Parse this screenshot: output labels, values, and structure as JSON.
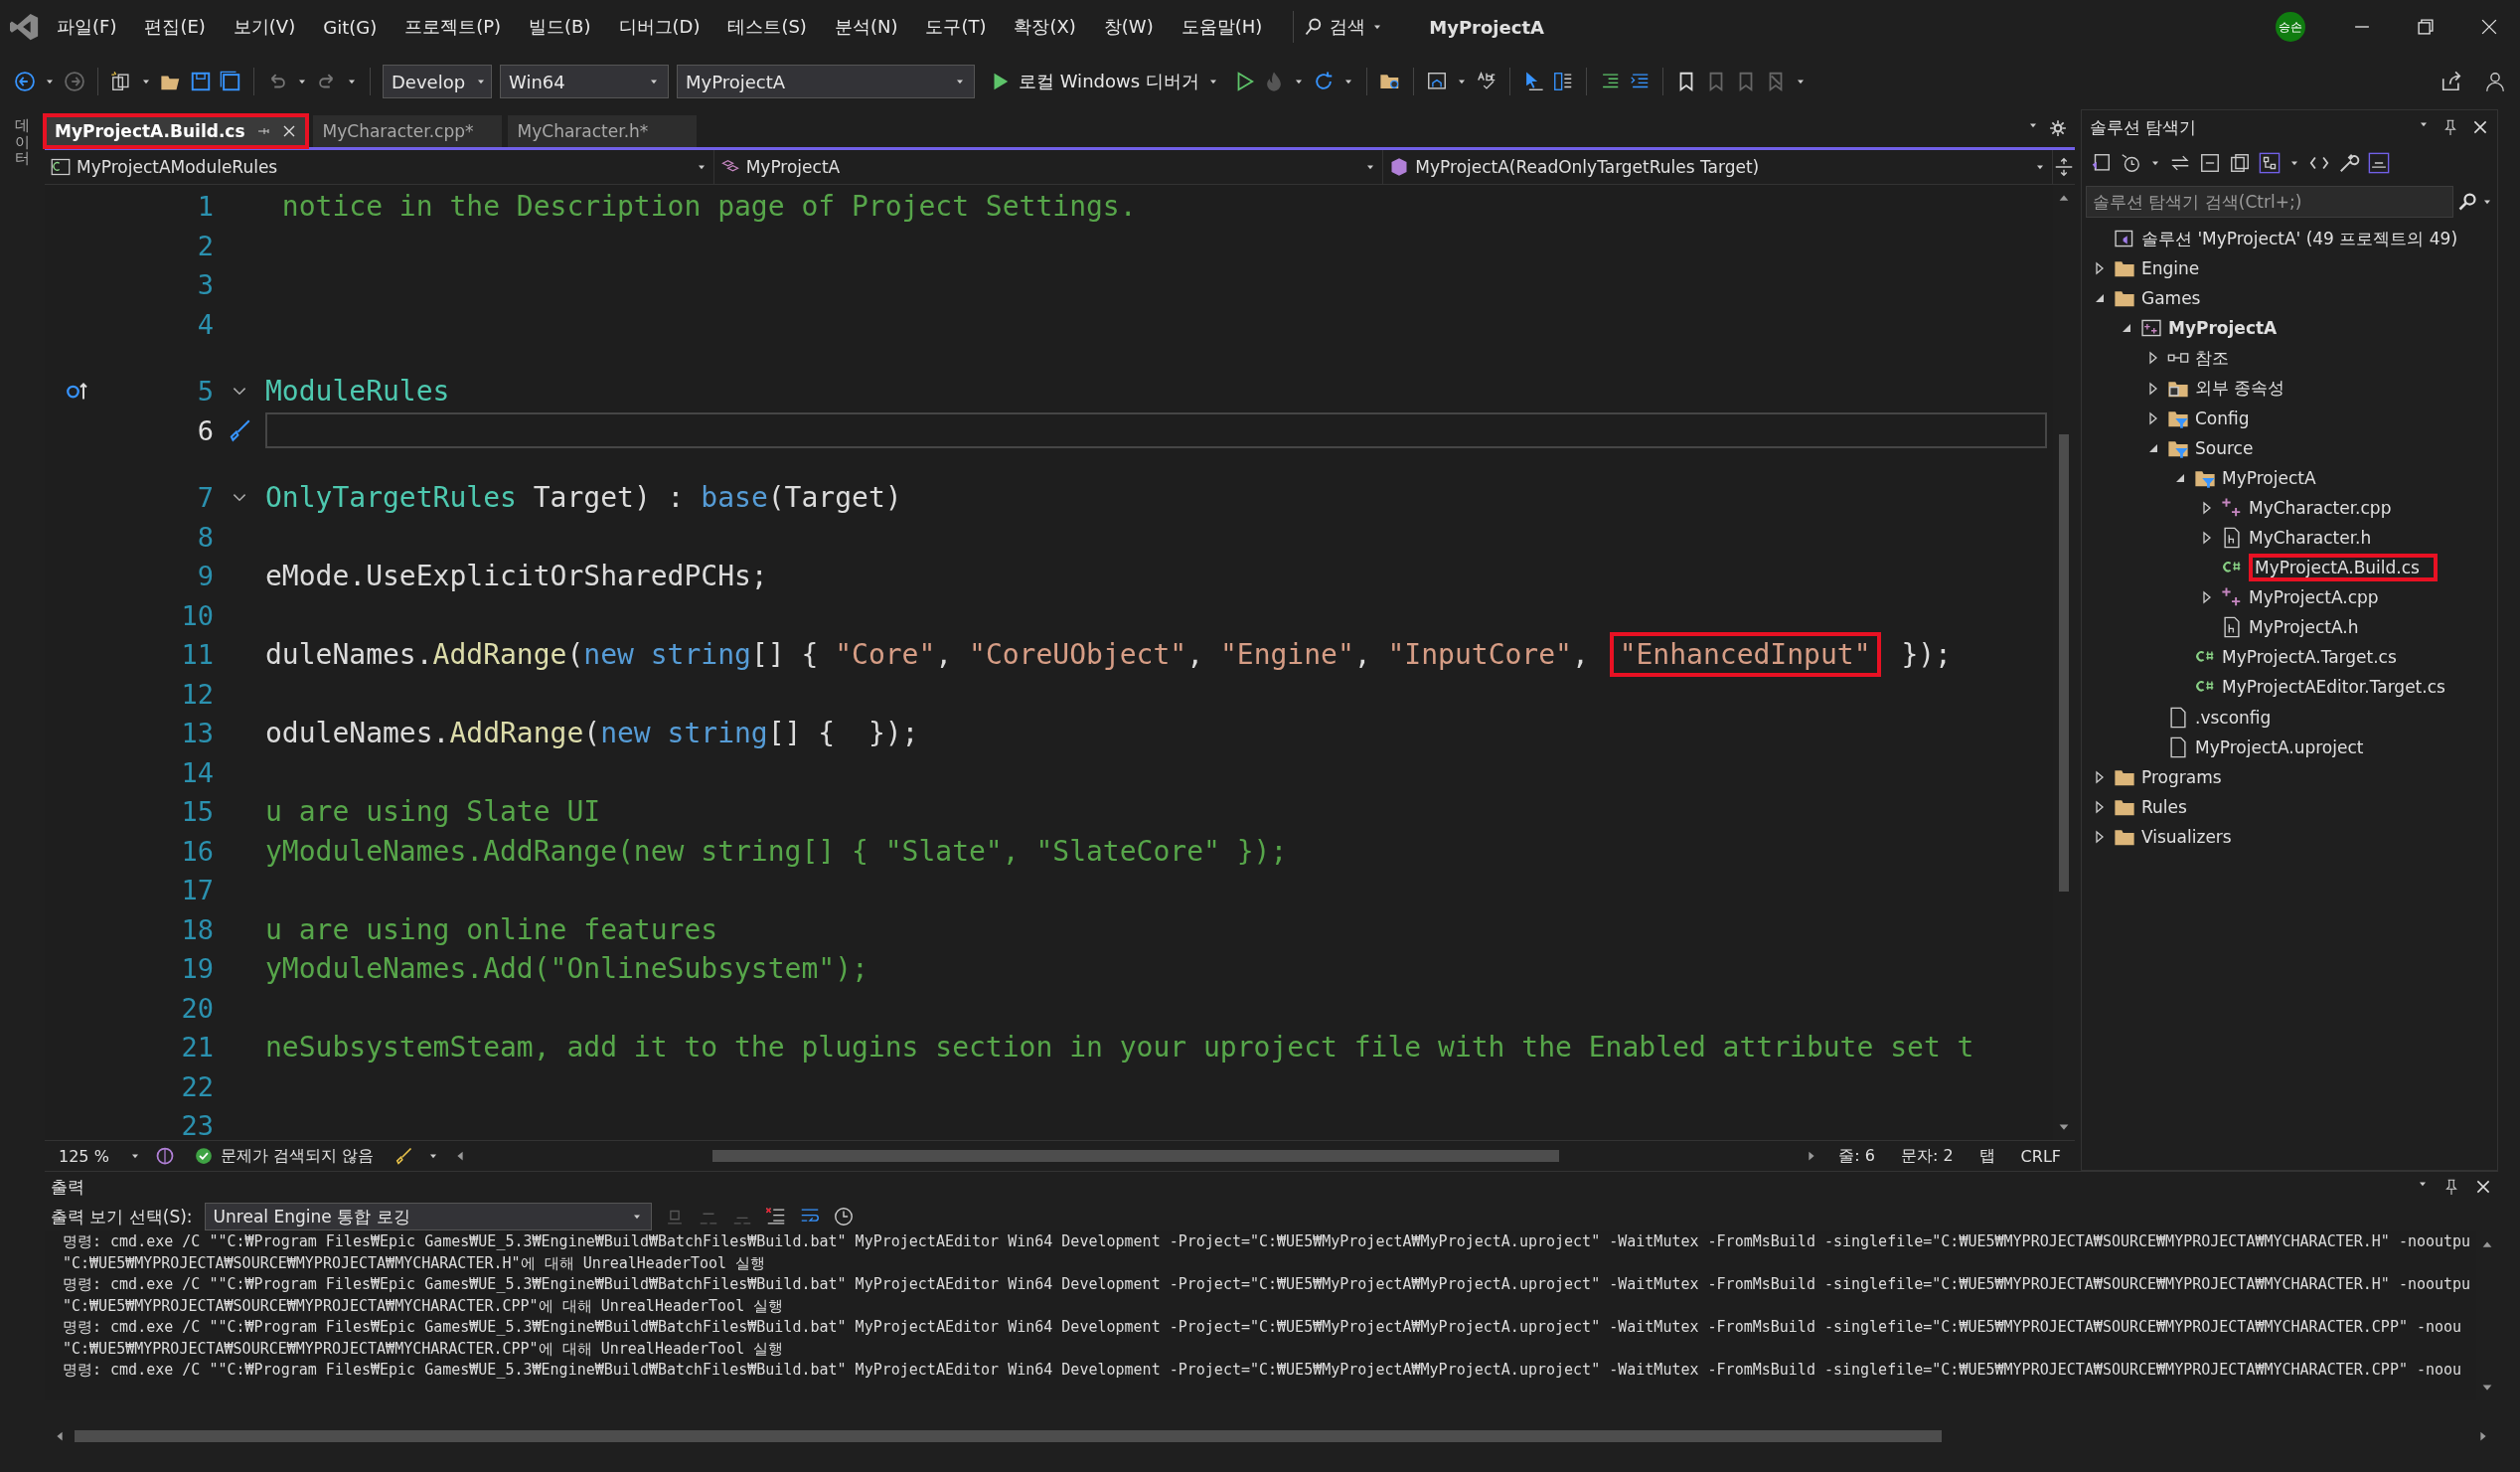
{
  "title_bar": {
    "menus": [
      "파일(F)",
      "편집(E)",
      "보기(V)",
      "Git(G)",
      "프로젝트(P)",
      "빌드(B)",
      "디버그(D)",
      "테스트(S)",
      "분석(N)",
      "도구(T)",
      "확장(X)",
      "창(W)",
      "도움말(H)"
    ],
    "search": "검색",
    "title": "MyProjectA",
    "avatar": "승손"
  },
  "toolbar": {
    "dropdowns": [
      "Develop",
      "Win64",
      "MyProjectA"
    ],
    "run_label": "로컬 Windows 디버거"
  },
  "left_strip": {
    "label": "데이터"
  },
  "editor": {
    "tabs": [
      {
        "label": "MyProjectA.Build.cs",
        "selected": true,
        "annotated": true
      },
      {
        "label": "MyCharacter.cpp*",
        "selected": false,
        "annotated": false
      },
      {
        "label": "MyCharacter.h*",
        "selected": false,
        "annotated": false
      }
    ],
    "nav": [
      "MyProjectAModuleRules",
      "MyProjectA",
      "MyProjectA(ReadOnlyTargetRules Target)"
    ],
    "lines": [
      {
        "number": "1",
        "current": false,
        "fold": false,
        "tokens": [
          {
            "kind": "comment",
            "text": " notice in the Description page of Project Settings."
          }
        ]
      },
      {
        "number": "2",
        "current": false,
        "fold": false
      },
      {
        "number": "3",
        "current": false,
        "fold": false
      },
      {
        "number": "4",
        "current": false,
        "fold": false
      },
      {
        "number": "5",
        "current": false,
        "fold": true,
        "kind": "codelens",
        "tokens": [
          {
            "kind": "type",
            "text": "ModuleRules"
          }
        ]
      },
      {
        "number": "6",
        "current": true,
        "fold": false,
        "kind": "brush"
      },
      {
        "number": "7",
        "current": false,
        "fold": true,
        "tokens": [
          {
            "kind": "type",
            "text": "OnlyTargetRules"
          },
          {
            "kind": "plain",
            "text": " Target) : "
          },
          {
            "kind": "keyword",
            "text": "base"
          },
          {
            "kind": "plain",
            "text": "(Target)"
          }
        ]
      },
      {
        "number": "8",
        "current": false,
        "fold": false
      },
      {
        "number": "9",
        "current": false,
        "fold": false,
        "tokens": [
          {
            "kind": "plain",
            "text": "eMode.UseExplicitOrSharedPCHs;"
          }
        ]
      },
      {
        "number": "10",
        "current": false,
        "fold": false
      },
      {
        "number": "11",
        "current": false,
        "fold": false,
        "tokens": [
          {
            "kind": "plain",
            "text": "duleNames."
          },
          {
            "kind": "method",
            "text": "AddRange"
          },
          {
            "kind": "plain",
            "text": "("
          },
          {
            "kind": "keyword",
            "text": "new string"
          },
          {
            "kind": "plain",
            "text": "[] { "
          },
          {
            "kind": "string",
            "text": "\"Core\""
          },
          {
            "kind": "plain",
            "text": ", "
          },
          {
            "kind": "string",
            "text": "\"CoreUObject\""
          },
          {
            "kind": "plain",
            "text": ", "
          },
          {
            "kind": "string",
            "text": "\"Engine\""
          },
          {
            "kind": "plain",
            "text": ", "
          },
          {
            "kind": "string",
            "text": "\"InputCore\""
          },
          {
            "kind": "plain",
            "text": ", "
          },
          {
            "kind": "boxed-string",
            "text": "\"EnhancedInput\""
          },
          {
            "kind": "plain",
            "text": " });"
          }
        ]
      },
      {
        "number": "12",
        "current": false,
        "fold": false
      },
      {
        "number": "13",
        "current": false,
        "fold": false,
        "tokens": [
          {
            "kind": "plain",
            "text": "oduleNames."
          },
          {
            "kind": "method",
            "text": "AddRange"
          },
          {
            "kind": "plain",
            "text": "("
          },
          {
            "kind": "keyword",
            "text": "new string"
          },
          {
            "kind": "plain",
            "text": "[] {  });"
          }
        ]
      },
      {
        "number": "14",
        "current": false,
        "fold": false
      },
      {
        "number": "15",
        "current": false,
        "fold": false,
        "tokens": [
          {
            "kind": "comment",
            "text": "u are using Slate UI"
          }
        ]
      },
      {
        "number": "16",
        "current": false,
        "fold": false,
        "tokens": [
          {
            "kind": "comment",
            "text": "yModuleNames.AddRange(new string[] { \"Slate\", \"SlateCore\" });"
          }
        ]
      },
      {
        "number": "17",
        "current": false,
        "fold": false
      },
      {
        "number": "18",
        "current": false,
        "fold": false,
        "tokens": [
          {
            "kind": "comment",
            "text": "u are using online features"
          }
        ]
      },
      {
        "number": "19",
        "current": false,
        "fold": false,
        "tokens": [
          {
            "kind": "comment",
            "text": "yModuleNames.Add(\"OnlineSubsystem\");"
          }
        ]
      },
      {
        "number": "20",
        "current": false,
        "fold": false
      },
      {
        "number": "21",
        "current": false,
        "fold": false,
        "tokens": [
          {
            "kind": "comment",
            "text": "neSubsystemSteam, add it to the plugins section in your uproject file with the Enabled attribute set t"
          }
        ]
      },
      {
        "number": "22",
        "current": false,
        "fold": false
      },
      {
        "number": "23",
        "current": false,
        "fold": false
      }
    ],
    "status": {
      "zoom": "125 %",
      "issues": "문제가 검색되지 않음",
      "line": "줄: 6",
      "column": "문자: 2",
      "indent": "탭",
      "eol": "CRLF"
    }
  },
  "solution_explorer": {
    "title": "솔루션 탐색기",
    "search_placeholder": "솔루션 탐색기 검색(Ctrl+;)",
    "tree": [
      {
        "label": "솔루션 'MyProjectA'  (49 프로젝트의 49)",
        "kind": "solution",
        "annotated": false
      },
      {
        "label": "Engine",
        "kind": "folder",
        "expanded": false,
        "annotated": false
      },
      {
        "label": "Games",
        "kind": "folder",
        "expanded": true,
        "annotated": false,
        "children": [
          {
            "label": "MyProjectA",
            "kind": "project",
            "expanded": true,
            "annotated": false,
            "children": [
              {
                "label": "참조",
                "kind": "references",
                "expanded": false,
                "annotated": false
              },
              {
                "label": "외부 종속성",
                "kind": "external",
                "expanded": false,
                "annotated": false
              },
              {
                "label": "Config",
                "kind": "filter",
                "expanded": false,
                "annotated": false
              },
              {
                "label": "Source",
                "kind": "filter",
                "expanded": true,
                "annotated": false,
                "children": [
                  {
                    "label": "MyProjectA",
                    "kind": "filter",
                    "expanded": true,
                    "annotated": false,
                    "children": [
                      {
                        "label": "MyCharacter.cpp",
                        "kind": "cpp",
                        "expanded": false,
                        "annotated": false
                      },
                      {
                        "label": "MyCharacter.h",
                        "kind": "header",
                        "expanded": false,
                        "annotated": false
                      },
                      {
                        "label": "MyProjectA.Build.cs",
                        "kind": "csharp",
                        "annotated": true
                      },
                      {
                        "label": "MyProjectA.cpp",
                        "kind": "cpp",
                        "expanded": false,
                        "annotated": false
                      },
                      {
                        "label": "MyProjectA.h",
                        "kind": "header",
                        "annotated": false
                      }
                    ]
                  },
                  {
                    "label": "MyProjectA.Target.cs",
                    "kind": "csharp",
                    "annotated": false
                  },
                  {
                    "label": "MyProjectAEditor.Target.cs",
                    "kind": "csharp",
                    "annotated": false
                  }
                ]
              },
              {
                "label": ".vsconfig",
                "kind": "file",
                "annotated": false
              },
              {
                "label": "MyProjectA.uproject",
                "kind": "file",
                "annotated": false
              }
            ]
          }
        ]
      },
      {
        "label": "Programs",
        "kind": "folder",
        "expanded": false,
        "annotated": false
      },
      {
        "label": "Rules",
        "kind": "folder",
        "expanded": false,
        "annotated": false
      },
      {
        "label": "Visualizers",
        "kind": "folder",
        "expanded": false,
        "annotated": false
      }
    ]
  },
  "output": {
    "title": "출력",
    "source_label": "출력 보기 선택(S):",
    "source": "Unreal Engine 통합 로깅",
    "lines": [
      "명령: cmd.exe /C \"\"C:₩Program Files₩Epic Games₩UE_5.3₩Engine₩Build₩BatchFiles₩Build.bat\" MyProjectAEditor Win64 Development -Project=\"C:₩UE5₩MyProjectA₩MyProjectA.uproject\" -WaitMutex -FromMsBuild -singlefile=\"C:₩UE5₩MYPROJECTA₩SOURCE₩MYPROJECTA₩MYCHARACTER.H\" -nooutpu",
      "\"C:₩UE5₩MYPROJECTA₩SOURCE₩MYPROJECTA₩MYCHARACTER.H\"에 대해 UnrealHeaderTool 실행",
      "명령: cmd.exe /C \"\"C:₩Program Files₩Epic Games₩UE_5.3₩Engine₩Build₩BatchFiles₩Build.bat\" MyProjectAEditor Win64 Development -Project=\"C:₩UE5₩MyProjectA₩MyProjectA.uproject\" -WaitMutex -FromMsBuild -singlefile=\"C:₩UE5₩MYPROJECTA₩SOURCE₩MYPROJECTA₩MYCHARACTER.H\" -nooutpu",
      "\"C:₩UE5₩MYPROJECTA₩SOURCE₩MYPROJECTA₩MYCHARACTER.CPP\"에 대해 UnrealHeaderTool 실행",
      "명령: cmd.exe /C \"\"C:₩Program Files₩Epic Games₩UE_5.3₩Engine₩Build₩BatchFiles₩Build.bat\" MyProjectAEditor Win64 Development -Project=\"C:₩UE5₩MyProjectA₩MyProjectA.uproject\" -WaitMutex -FromMsBuild -singlefile=\"C:₩UE5₩MYPROJECTA₩SOURCE₩MYPROJECTA₩MYCHARACTER.CPP\" -noou",
      "\"C:₩UE5₩MYPROJECTA₩SOURCE₩MYPROJECTA₩MYCHARACTER.CPP\"에 대해 UnrealHeaderTool 실행",
      "명령: cmd.exe /C \"\"C:₩Program Files₩Epic Games₩UE_5.3₩Engine₩Build₩BatchFiles₩Build.bat\" MyProjectAEditor Win64 Development -Project=\"C:₩UE5₩MyProjectA₩MyProjectA.uproject\" -WaitMutex -FromMsBuild -singlefile=\"C:₩UE5₩MYPROJECTA₩SOURCE₩MYPROJECTA₩MYCHARACTER.CPP\" -noou"
    ]
  }
}
